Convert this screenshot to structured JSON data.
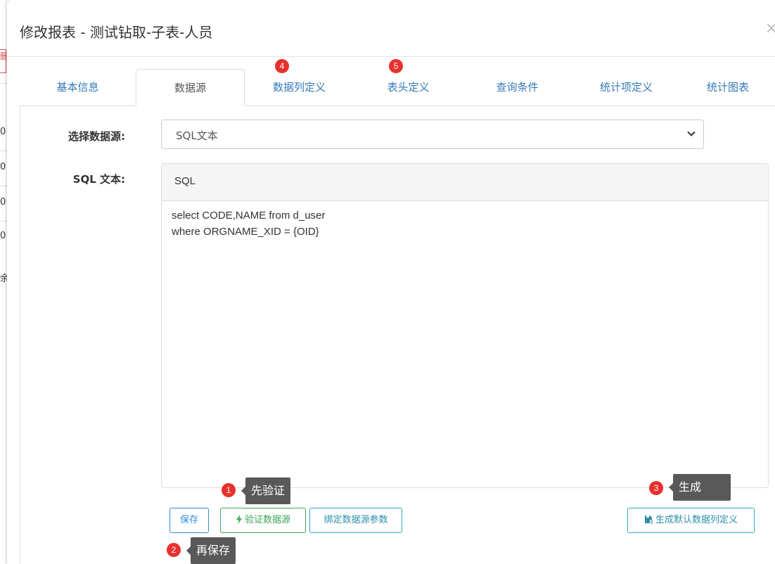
{
  "modal": {
    "title": "修改报表 - 测试钻取-子表-人员",
    "close_glyph": "×"
  },
  "tabs": [
    {
      "label": "基本信息",
      "active": false
    },
    {
      "label": "数据源",
      "active": true
    },
    {
      "label": "数据列定义",
      "active": false,
      "badge": "4"
    },
    {
      "label": "表头定义",
      "active": false,
      "badge": "5"
    },
    {
      "label": "查询条件",
      "active": false
    },
    {
      "label": "统计项定义",
      "active": false
    },
    {
      "label": "统计图表",
      "active": false
    }
  ],
  "form": {
    "datasource_label": "选择数据源:",
    "datasource_value": "SQL文本",
    "sql_label": "SQL 文本:",
    "sql_panel_title": "SQL",
    "sql_text": "select CODE,NAME from d_user\nwhere ORGNAME_XID = {OID}"
  },
  "buttons": {
    "save": "保存",
    "validate": "验证数据源",
    "validate_icon": "bolt-icon",
    "bind_params": "绑定数据源参数",
    "generate": "生成默认数据列定义",
    "generate_icon": "save-generate-icon"
  },
  "annotations": [
    {
      "number": "1",
      "text": "先验证"
    },
    {
      "number": "2",
      "text": "再保存"
    },
    {
      "number": "3",
      "text": "生成"
    }
  ],
  "background": {
    "row_digits": [
      "0",
      "0",
      "0",
      "0"
    ],
    "partial_char": "余",
    "partial_mark": "删"
  },
  "colors": {
    "badge": "#e8312e",
    "link": "#337ab7",
    "primary": "#2e8bd8",
    "success": "#3aa655",
    "info": "#33a5c4",
    "tooltip": "#595959"
  }
}
